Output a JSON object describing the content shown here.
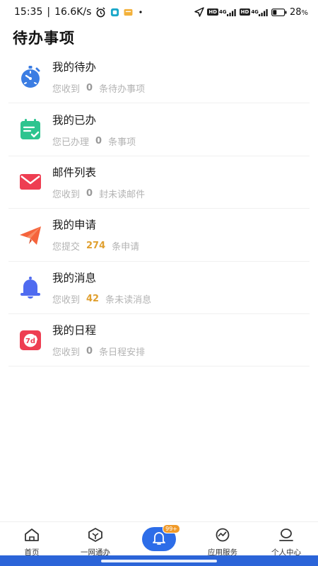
{
  "status": {
    "time": "15:35",
    "speed": "16.6K/s",
    "battery": "28",
    "battery_suffix": "%"
  },
  "page": {
    "title": "待办事项"
  },
  "items": [
    {
      "title": "我的待办",
      "prefix": "您收到",
      "count": "0",
      "suffix": "条待办事项",
      "icon": "stopwatch-icon",
      "color": "#3b7de3"
    },
    {
      "title": "我的已办",
      "prefix": "您已办理",
      "count": "0",
      "suffix": "条事项",
      "icon": "done-list-icon",
      "color": "#2ec48f"
    },
    {
      "title": "邮件列表",
      "prefix": "您收到",
      "count": "0",
      "suffix": "封未读邮件",
      "icon": "envelope-icon",
      "color": "#ee3e52"
    },
    {
      "title": "我的申请",
      "prefix": "您提交",
      "count": "274",
      "suffix": "条申请",
      "icon": "paper-plane-icon",
      "color": "#f5643c"
    },
    {
      "title": "我的消息",
      "prefix": "您收到",
      "count": "42",
      "suffix": "条未读消息",
      "icon": "bell-icon",
      "color": "#4f6bf0"
    },
    {
      "title": "我的日程",
      "prefix": "您收到",
      "count": "0",
      "suffix": "条日程安排",
      "icon": "calendar-7d-icon",
      "color": "#ee3e52"
    }
  ],
  "tabbar": {
    "tabs": [
      {
        "label": "首页",
        "icon": "home-icon"
      },
      {
        "label": "一网通办",
        "icon": "cube-icon"
      },
      {
        "label": "",
        "icon": "bell-icon",
        "badge": "99+"
      },
      {
        "label": "应用服务",
        "icon": "trend-icon"
      },
      {
        "label": "个人中心",
        "icon": "person-icon"
      }
    ]
  }
}
